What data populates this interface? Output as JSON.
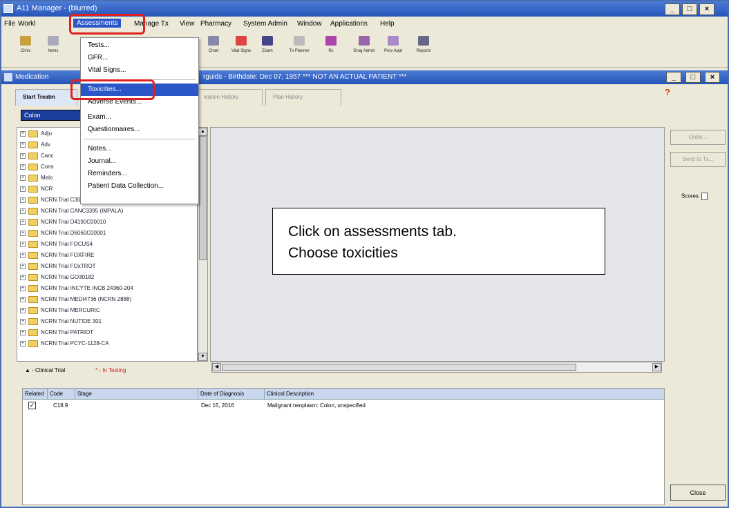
{
  "window": {
    "title": "A11 Manager - (blurred)"
  },
  "menubar": {
    "items": [
      "File",
      "Workl",
      "Assessments",
      "Manage Tx",
      "View",
      "Pharmacy",
      "System Admin",
      "Window",
      "Applications",
      "Help"
    ]
  },
  "toolbar": {
    "items": [
      "Clinic",
      "Items",
      "Chart",
      "Vital Signs",
      "Exam",
      "Tx Planner",
      "Rx",
      "Drug Admin",
      "Prov Appt",
      "Reports"
    ]
  },
  "child": {
    "title_left": "Medication",
    "title_right": "rguids - Birthdate: Dec 07, 1957 *** NOT AN ACTUAL PATIENT ***"
  },
  "tabs": [
    "Start Treatm",
    "ication History",
    "Plan History"
  ],
  "dropdown": {
    "value": "Colon"
  },
  "tree": [
    "Adju",
    "Adv",
    "Canc",
    "Cons",
    "Melo",
    "NCR",
    "NCRN Trial C30000",
    "NCRN Trial CANC3395 (IMPALA)",
    "NCRN Trial D4190C00010",
    "NCRN Trial D6060C00001",
    "NCRN Trial FOCUS4",
    "NCRN Trial FOXFIRE",
    "NCRN Trial FOxTROT",
    "NCRN Trial GO30182",
    "NCRN Trial INCYTE INCB 24360-204",
    "NCRN Trial MEDI4736 (NCRN 2888)",
    "NCRN Trial MERCURIC",
    "NCRN Trial NUTIDE 301",
    "NCRN Trial PATRIOT",
    "NCRN Trial PCYC-1128-CA"
  ],
  "legend": {
    "clinical_trial": "- Clinical Trial",
    "in_testing": "* - In Testing"
  },
  "right_buttons": {
    "order": "Order...",
    "send": "Send to Tx...",
    "scores": "Scores"
  },
  "diagnosis": {
    "headers": [
      "Related",
      "Code",
      "Stage",
      "Date of Diagnosis",
      "Clinical Description"
    ],
    "rows": [
      {
        "checked": "✓",
        "code": "C18.9",
        "stage": "",
        "date": "Dec 15, 2016",
        "desc": "Malignant neoplasm: Colon, unspecified"
      }
    ]
  },
  "close": "Close",
  "assessments_menu": [
    "Tests...",
    "GFR...",
    "Vital Signs...",
    "Toxicities...",
    "Adverse Events...",
    "Exam...",
    "Questionnaires...",
    "Notes...",
    "Journal...",
    "Reminders...",
    "Patient Data Collection..."
  ],
  "callout": {
    "line1": "Click on assessments tab.",
    "line2": "Choose toxicities"
  },
  "colors": {
    "titlebar": "#2654b8",
    "highlight": "#2a56c8",
    "annotation": "#e02020"
  }
}
